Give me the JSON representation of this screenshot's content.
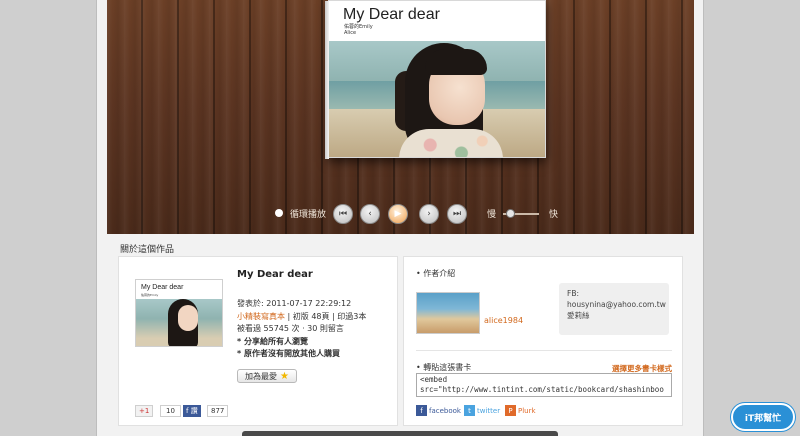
{
  "book": {
    "title": "My Dear dear",
    "subtitle1": "佑蓉的Emily",
    "subtitle2": "Alice"
  },
  "controls": {
    "loop_label": "循環播放",
    "prev_first": "⏮",
    "prev": "‹",
    "play": "▶",
    "next": "›",
    "next_last": "⏭",
    "speed_slow": "慢",
    "speed_fast": "快",
    "speed_level": 0.2
  },
  "about": {
    "section_title": "關於這個作品",
    "work_title": "My Dear dear",
    "thumb_title": "My Dear dear",
    "thumb_sub": "佑蓉的Emily",
    "published": "發表於: 2011-07-17 22:29:12",
    "product": "小精裝寫真本",
    "edition": " | 初版 48頁 | 印過3本",
    "views": "被看過 55745 次 · 30 則留言",
    "note1": "* 分享給所有人瀏覽",
    "note2": "* 原作者沒有開放其他人購買",
    "fav_label": "加為最愛",
    "gplus_label": "+1",
    "gplus_count": "10",
    "fb_label": "f 讚",
    "fb_count": "877"
  },
  "author": {
    "heading": "• 作者介紹",
    "name": "alice1984",
    "bubble_line1": "FB:",
    "bubble_line2": "housynina@yahoo.com.tw",
    "bubble_line3": "愛莉絲",
    "embed_heading": "• 轉貼這張書卡",
    "more_styles": "選擇更多書卡樣式",
    "embed_code": "<embed\nsrc=\"http://www.tintint.com/static/bookcard/shashinbook-",
    "share_facebook": "facebook",
    "share_twitter": "twitter",
    "share_plurk": "Plurk"
  },
  "badge": {
    "label": "iT邦幫忙"
  },
  "colors": {
    "accent": "#d2691e",
    "facebook": "#3b5998",
    "twitter": "#4aa3df",
    "plurk": "#e06a2a"
  }
}
